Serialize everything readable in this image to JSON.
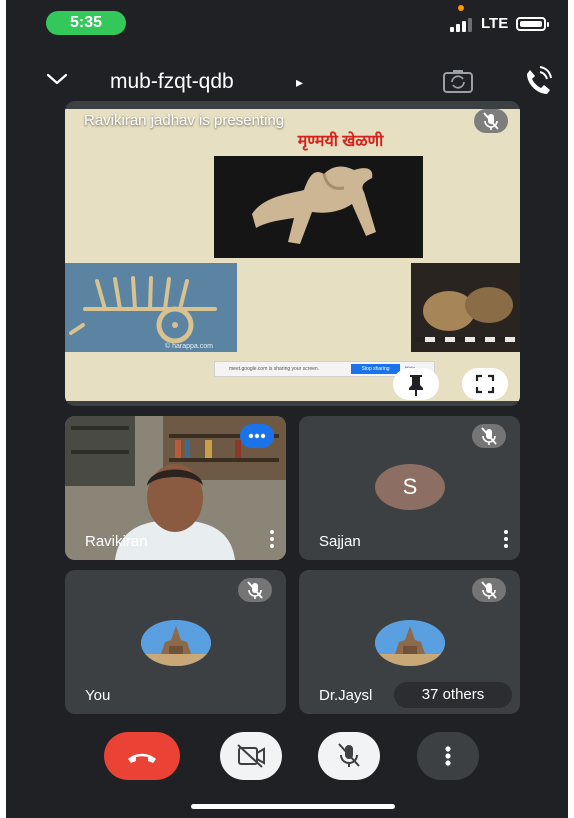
{
  "status_bar": {
    "time": "5:35",
    "network": "LTE"
  },
  "header": {
    "meeting_code": "mub-fzqt-qdb",
    "caret": "▸"
  },
  "presentation": {
    "presenter_label": "Ravikiran jadhav is presenting",
    "slide_title": "मृण्मयी खेळणी",
    "image_caption": "© harappa.com",
    "share_bar": {
      "message": "meet.google.com is sharing your screen.",
      "stop_label": "Stop sharing",
      "hide_label": "Hide"
    }
  },
  "participants": [
    {
      "name": "Ravikiran",
      "avatar": "camera",
      "muted": false
    },
    {
      "name": "Sajjan",
      "avatar_letter": "S",
      "avatar_color": "#8d6e63",
      "muted": true
    },
    {
      "name": "You",
      "avatar": "temple-photo",
      "muted": true
    },
    {
      "name": "Dr.Jaysl",
      "avatar": "temple-photo",
      "muted": true,
      "others": "37 others"
    }
  ],
  "colors": {
    "hangup": "#ea4335",
    "accent": "#1a73e8",
    "tile": "#3c4043",
    "background": "#202124"
  },
  "icons": [
    "chevron-down-icon",
    "camera-switch-icon",
    "phone-audio-icon",
    "mic-off-icon",
    "pin-icon",
    "fullscreen-icon",
    "more-vert-icon",
    "more-horiz-icon",
    "hangup-icon",
    "camera-off-icon"
  ]
}
